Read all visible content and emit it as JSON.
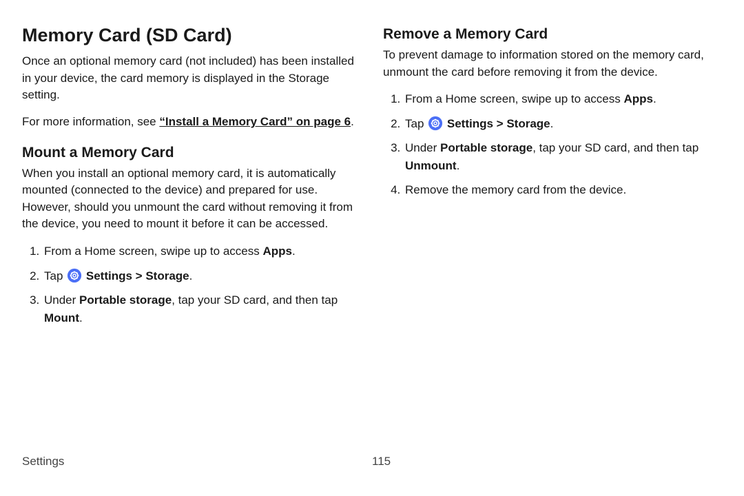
{
  "footer": {
    "section": "Settings",
    "page": "115"
  },
  "left": {
    "h1": "Memory Card (SD Card)",
    "intro": "Once an optional memory card (not included) has been installed in your device, the card memory is displayed in the Storage setting.",
    "moreinfo_prefix": "For more information, see ",
    "moreinfo_link": "“Install a Memory Card” on page 6",
    "moreinfo_suffix": ".",
    "h2": "Mount a Memory Card",
    "mount_intro": "When you install an optional memory card, it is automatically mounted (connected to the device) and prepared for use. However, should you unmount the card without removing it from the device, you need to mount it before it can be accessed.",
    "step1_a": "From a Home screen, swipe up to access ",
    "step1_b": "Apps",
    "step1_c": ".",
    "step2_a": "Tap ",
    "step2_b": "Settings",
    "step2_c": " > ",
    "step2_d": "Storage",
    "step2_e": ".",
    "step3_a": "Under ",
    "step3_b": "Portable storage",
    "step3_c": ", tap your SD card, and then tap ",
    "step3_d": "Mount",
    "step3_e": "."
  },
  "right": {
    "h2": "Remove a Memory Card",
    "intro": "To prevent damage to information stored on the memory card, unmount the card before removing it from the device.",
    "step1_a": "From a Home screen, swipe up to access ",
    "step1_b": "Apps",
    "step1_c": ".",
    "step2_a": "Tap ",
    "step2_b": "Settings",
    "step2_c": " > ",
    "step2_d": "Storage",
    "step2_e": ".",
    "step3_a": "Under ",
    "step3_b": "Portable storage",
    "step3_c": ", tap your SD card, and then tap ",
    "step3_d": "Unmount",
    "step3_e": ".",
    "step4": "Remove the memory card from the device."
  }
}
